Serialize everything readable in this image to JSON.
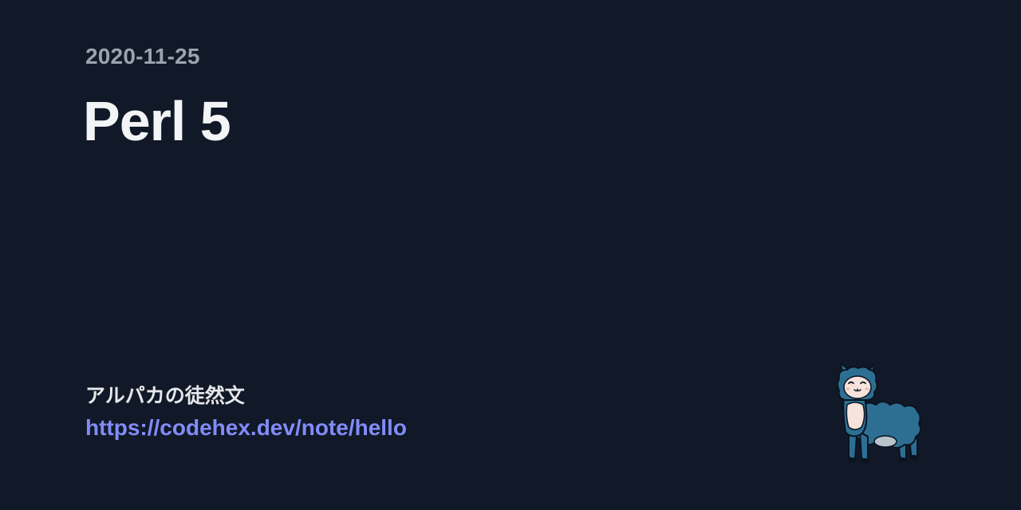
{
  "post": {
    "date": "2020-11-25",
    "title": "Perl 5"
  },
  "site": {
    "name": "アルパカの徒然文",
    "url": "https://codehex.dev/note/hello"
  },
  "mascot": {
    "icon": "alpaca-icon",
    "body_color": "#2d6f93",
    "face_color": "#f6e3dc"
  }
}
